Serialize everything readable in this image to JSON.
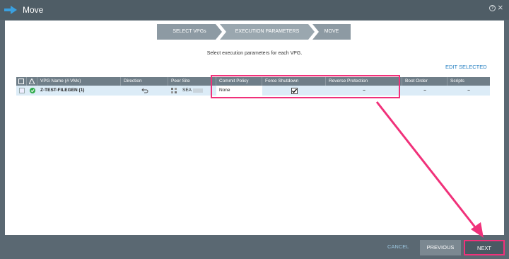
{
  "window": {
    "title": "Move"
  },
  "wizard": {
    "steps": [
      {
        "label": "SELECT VPGs",
        "active": false
      },
      {
        "label": "EXECUTION PARAMETERS",
        "active": true
      },
      {
        "label": "MOVE",
        "active": false
      }
    ]
  },
  "instruction": "Select execution parameters for each VPG.",
  "edit_selected": "EDIT SELECTED",
  "table": {
    "columns": [
      "VPG Name (# VMs)",
      "Direction",
      "Peer Site",
      "Commit Policy",
      "Force Shutdown",
      "Reverse Protection",
      "Boot Order",
      "Scripts"
    ],
    "rows": [
      {
        "vpg_name": "Z-TEST-FILEGEN (1)",
        "direction_icon": "undo-arrow-icon",
        "peer_site": "SEA",
        "commit_policy": "None",
        "force_shutdown": true,
        "reverse_protection": "–",
        "boot_order": "–",
        "scripts": "–"
      }
    ]
  },
  "footer": {
    "cancel": "CANCEL",
    "previous": "PREVIOUS",
    "next": "NEXT"
  },
  "colors": {
    "accent": "#2a82c3",
    "highlight": "#f0317a",
    "status_ok": "#2eaa4a"
  }
}
